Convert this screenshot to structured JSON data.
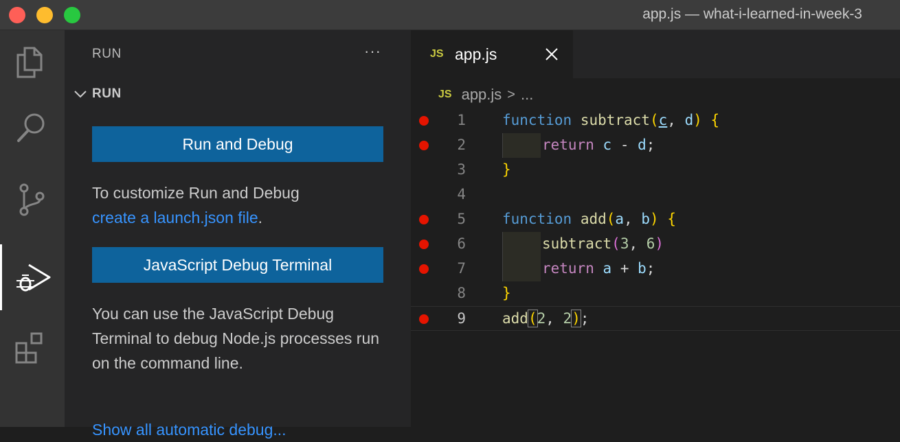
{
  "window": {
    "title": "app.js — what-i-learned-in-week-3"
  },
  "activity_bar": {
    "items": [
      {
        "icon": "files-icon"
      },
      {
        "icon": "search-icon"
      },
      {
        "icon": "source-control-icon"
      },
      {
        "icon": "run-debug-icon",
        "active": true
      },
      {
        "icon": "extensions-icon"
      }
    ]
  },
  "sidebar": {
    "title": "RUN",
    "more": "···",
    "section": "RUN",
    "run_debug_button": "Run and Debug",
    "customize_text": "To customize Run and Debug",
    "launch_link": "create a launch.json file",
    "period": ".",
    "js_terminal_button": "JavaScript Debug Terminal",
    "terminal_desc": "You can use the JavaScript Debug Terminal to debug Node.js processes run on the command line.",
    "cutoff_link": "Show all automatic debug..."
  },
  "editor": {
    "tab": {
      "icon": "JS",
      "label": "app.js"
    },
    "breadcrumb": {
      "icon": "JS",
      "file": "app.js",
      "sep": ">",
      "rest": "..."
    },
    "lines": [
      {
        "n": "1",
        "bp": true
      },
      {
        "n": "2",
        "bp": true
      },
      {
        "n": "3",
        "bp": false
      },
      {
        "n": "4",
        "bp": false
      },
      {
        "n": "5",
        "bp": true
      },
      {
        "n": "6",
        "bp": true
      },
      {
        "n": "7",
        "bp": true
      },
      {
        "n": "8",
        "bp": false
      },
      {
        "n": "9",
        "bp": true
      }
    ],
    "code": {
      "l1": {
        "kw": "function",
        "fn": "subtract",
        "open": "(",
        "p1": "c",
        "comma": ", ",
        "p2": "d",
        "close": ")",
        "brace": "{"
      },
      "l2": {
        "kw": "return",
        "a": "c",
        "op": " - ",
        "b": "d",
        "end": ";"
      },
      "l3": {
        "brace": "}"
      },
      "l5": {
        "kw": "function",
        "fn": "add",
        "open": "(",
        "p1": "a",
        "comma": ", ",
        "p2": "b",
        "close": ")",
        "brace": "{"
      },
      "l6": {
        "fn": "subtract",
        "open": "(",
        "n1": "3",
        "comma": ", ",
        "n2": "6",
        "close": ")"
      },
      "l7": {
        "kw": "return",
        "a": "a",
        "op": " + ",
        "b": "b",
        "end": ";"
      },
      "l8": {
        "brace": "}"
      },
      "l9": {
        "fn": "add",
        "open": "(",
        "n1": "2",
        "comma": ", ",
        "n2": "2",
        "close": ")",
        "end": ";"
      }
    }
  }
}
